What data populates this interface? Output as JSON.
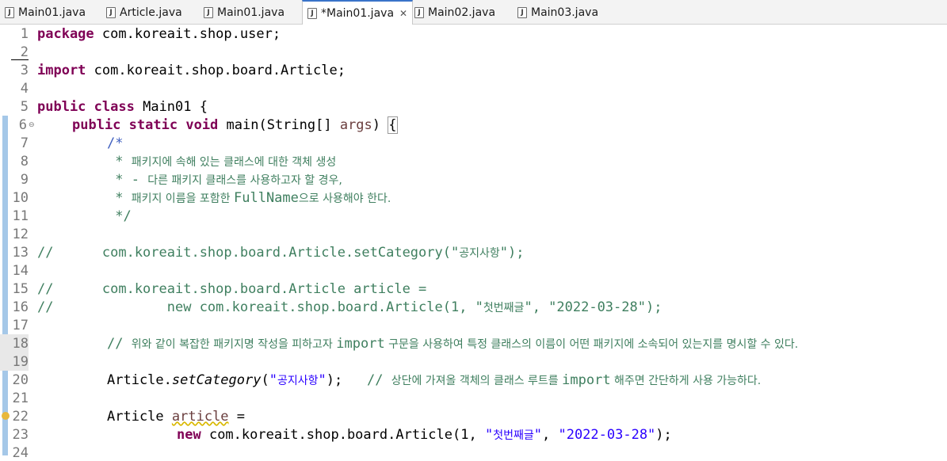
{
  "tabs": [
    {
      "label": "Main01.java",
      "active": false
    },
    {
      "label": "Article.java",
      "active": false
    },
    {
      "label": "Main01.java",
      "active": false
    },
    {
      "label": "*Main01.java",
      "active": true
    },
    {
      "label": "Main02.java",
      "active": false
    },
    {
      "label": "Main03.java",
      "active": false
    }
  ],
  "editor": {
    "line_numbers": [
      "1",
      "2",
      "3",
      "4",
      "5",
      "6",
      "7",
      "8",
      "9",
      "10",
      "11",
      "12",
      "13",
      "14",
      "15",
      "16",
      "17",
      "18",
      "19",
      "20",
      "21",
      "22",
      "23",
      "24"
    ],
    "code": {
      "l1_kw": "package",
      "l1_rest": " com.koreait.shop.user;",
      "l3_kw": "import",
      "l3_rest": " com.koreait.shop.board.Article;",
      "l5_kw1": "public",
      "l5_kw2": "class",
      "l5_rest": " Main01 {",
      "l6_kw1": "public",
      "l6_kw2": "static",
      "l6_kw3": "void",
      "l6_rest": " main(String[] ",
      "l6_args": "args",
      "l6_close": ") ",
      "l6_brace": "{",
      "l7": "/*",
      "l8_star": " * ",
      "l8_ko": "패키지에 속해 있는 클래스에 대한 객체 생성",
      "l9_star": " * - ",
      "l9_ko": "다른 패키지 클래스를 사용하고자 할 경우,",
      "l10_star": " * ",
      "l10_ko1": "패키지 이름을 포함한 ",
      "l10_en": "FullName",
      "l10_ko2": "으로 사용해야 한다.",
      "l11": " */",
      "l13_cm": "//      com.koreait.shop.board.Article.setCategory(\"",
      "l13_ko": "공지사항",
      "l13_end": "\");",
      "l15": "//      com.koreait.shop.board.Article article =",
      "l16_a": "//              new com.koreait.shop.board.Article(1, \"",
      "l16_ko": "첫번째글",
      "l16_b": "\", \"2022-03-28\");",
      "l18_a": "// ",
      "l18_ko1": "위와 같이 복잡한 패키지명 작성을 피하고자 ",
      "l18_en": "import",
      "l18_ko2": " 구문을 사용하여 특정 클래스의 이름이 어떤 패키지에 소속되어 있는지를 명시할 수 있다.",
      "l20_a": "Article.",
      "l20_method": "setCategory",
      "l20_b": "(",
      "l20_str1": "\"",
      "l20_ko": "공지사항",
      "l20_str2": "\"",
      "l20_c": ");",
      "l20_cm": "// ",
      "l20_cko1": "상단에 가져올 객체의 클래스 루트를 ",
      "l20_cen": "import",
      "l20_cko2": " 해주면 간단하게 사용 가능하다.",
      "l22_a": "Article ",
      "l22_var": "article",
      "l22_b": " =",
      "l23_kw": "new",
      "l23_a": " com.koreait.shop.board.Article(1, ",
      "l23_s1": "\"",
      "l23_ko": "첫번째글",
      "l23_s2": "\"",
      "l23_b": ", ",
      "l23_date": "\"2022-03-28\"",
      "l23_c": ");"
    }
  },
  "colors": {
    "keyword": "#7f0055",
    "comment": "#3f7f5f",
    "javadoc": "#3f5fbf",
    "string": "#2a00ff",
    "active_tab_accent": "#3a73c9"
  }
}
